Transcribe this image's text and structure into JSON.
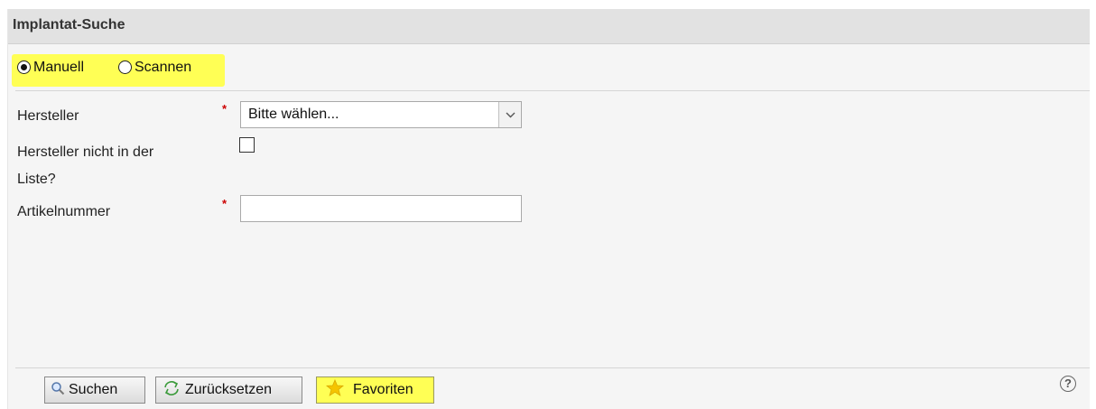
{
  "panel": {
    "title": "Implantat-Suche"
  },
  "mode": {
    "options": [
      {
        "label": "Manuell",
        "selected": true
      },
      {
        "label": "Scannen",
        "selected": false
      }
    ],
    "highlight_color": "#ffff55"
  },
  "form": {
    "required_marker": "*",
    "manufacturer": {
      "label": "Hersteller",
      "select_value": "Bitte wählen..."
    },
    "not_in_list": {
      "label_line1": "Hersteller nicht in der",
      "label_line2": "Liste?",
      "checked": false
    },
    "article_number": {
      "label": "Artikelnummer",
      "value": ""
    }
  },
  "buttons": {
    "search": "Suchen",
    "reset": "Zurücksetzen",
    "favorites": "Favoriten"
  },
  "icons": {
    "search": "magnifier-icon",
    "reset": "refresh-arrows-icon",
    "favorites": "star-icon",
    "help": "help-icon",
    "select": "chevron-down-icon"
  },
  "help": {
    "glyph": "?"
  }
}
